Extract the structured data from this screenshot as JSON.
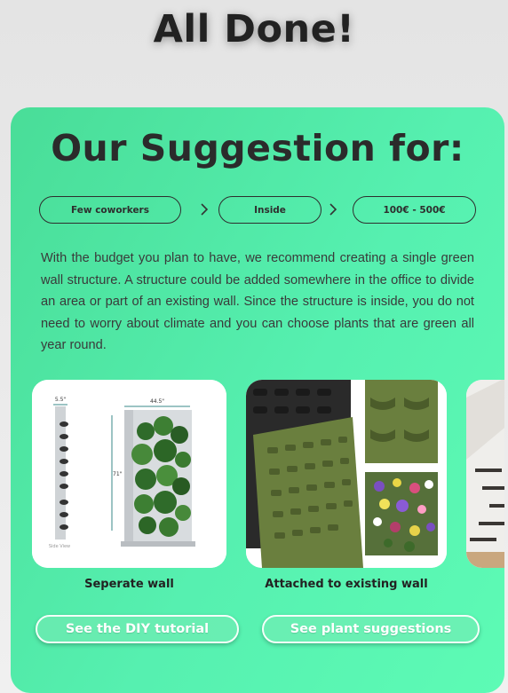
{
  "header": {
    "title": "All Done!"
  },
  "card": {
    "title": "Our Suggestion for:",
    "breadcrumbs": [
      "Few coworkers",
      "Inside",
      "100€ - 500€"
    ],
    "description": "With the budget you plan to have, we recommend creating a single green wall structure. A structure could be added somewhere in the office to divide an area or part of an existing wall. Since the structure is inside, you do not need to worry about climate and you can choose plants that are green all year round.",
    "options": [
      {
        "caption": "Seperate wall",
        "button": "See the DIY tutorial",
        "dims": {
          "depth": "5.5\"",
          "width": "44.5\"",
          "height": "71\"",
          "side_label": "Side View"
        }
      },
      {
        "caption": "Attached to existing wall",
        "button": "See plant suggestions"
      },
      {
        "caption": ""
      }
    ]
  },
  "colors": {
    "card_start": "#49dd98",
    "card_end": "#5dfbb5",
    "text_dark": "#2b2b2b",
    "felt_green": "#6a7f3e"
  }
}
